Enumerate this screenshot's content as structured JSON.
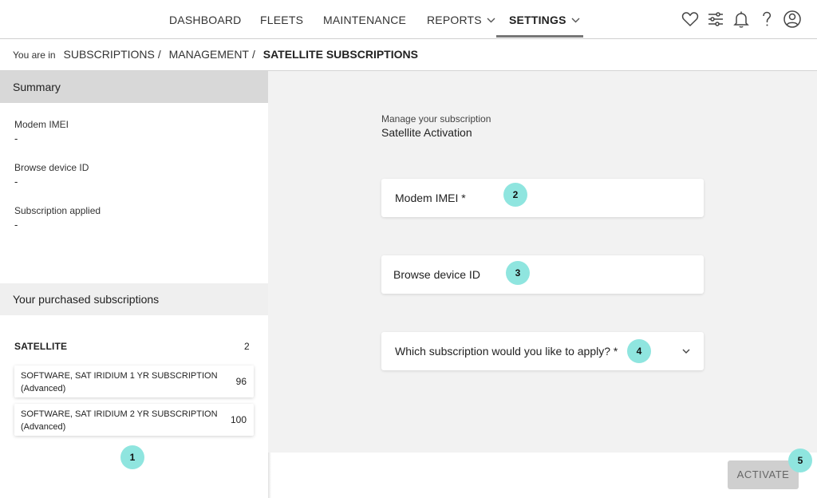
{
  "nav": {
    "items": [
      {
        "label": "DASHBOARD"
      },
      {
        "label": "FLEETS"
      },
      {
        "label": "MAINTENANCE"
      },
      {
        "label": "REPORTS"
      },
      {
        "label": "SETTINGS"
      }
    ],
    "active": "SETTINGS",
    "icons": [
      "heart-icon",
      "sliders-icon",
      "bell-icon",
      "help-icon",
      "user-icon"
    ]
  },
  "breadcrumb": {
    "prefix": "You are in",
    "crumbs": [
      "SUBSCRIPTIONS",
      "MANAGEMENT"
    ],
    "separator": "/",
    "current": "SATELLITE SUBSCRIPTIONS"
  },
  "summary": {
    "title": "Summary",
    "fields": [
      {
        "label": "Modem IMEI",
        "value": "-"
      },
      {
        "label": "Browse device ID",
        "value": "-"
      },
      {
        "label": "Subscription applied",
        "value": "-"
      }
    ]
  },
  "purchased": {
    "title": "Your purchased subscriptions",
    "group": "SATELLITE",
    "group_count": "2",
    "items": [
      {
        "name": "SOFTWARE, SAT IRIDIUM 1 YR SUBSCRIPTION",
        "tier": "(Advanced)",
        "count": "96"
      },
      {
        "name": "SOFTWARE, SAT IRIDIUM 2 YR SUBSCRIPTION",
        "tier": "(Advanced)",
        "count": "100"
      }
    ]
  },
  "form": {
    "label": "Manage your subscription",
    "title": "Satellite Activation",
    "modem_imei_placeholder": "Modem IMEI *",
    "device_id_placeholder": "Browse device ID",
    "subscription_placeholder": "Which subscription would you like to apply? *"
  },
  "actions": {
    "activate_label": "ACTIVATE"
  },
  "badges": [
    "1",
    "2",
    "3",
    "4",
    "5"
  ],
  "colors": {
    "badge": "#8fe5df",
    "summary_header": "#d8d8d8",
    "main_bg": "#f2f2f2",
    "activate_bg": "#cfcfcf"
  }
}
